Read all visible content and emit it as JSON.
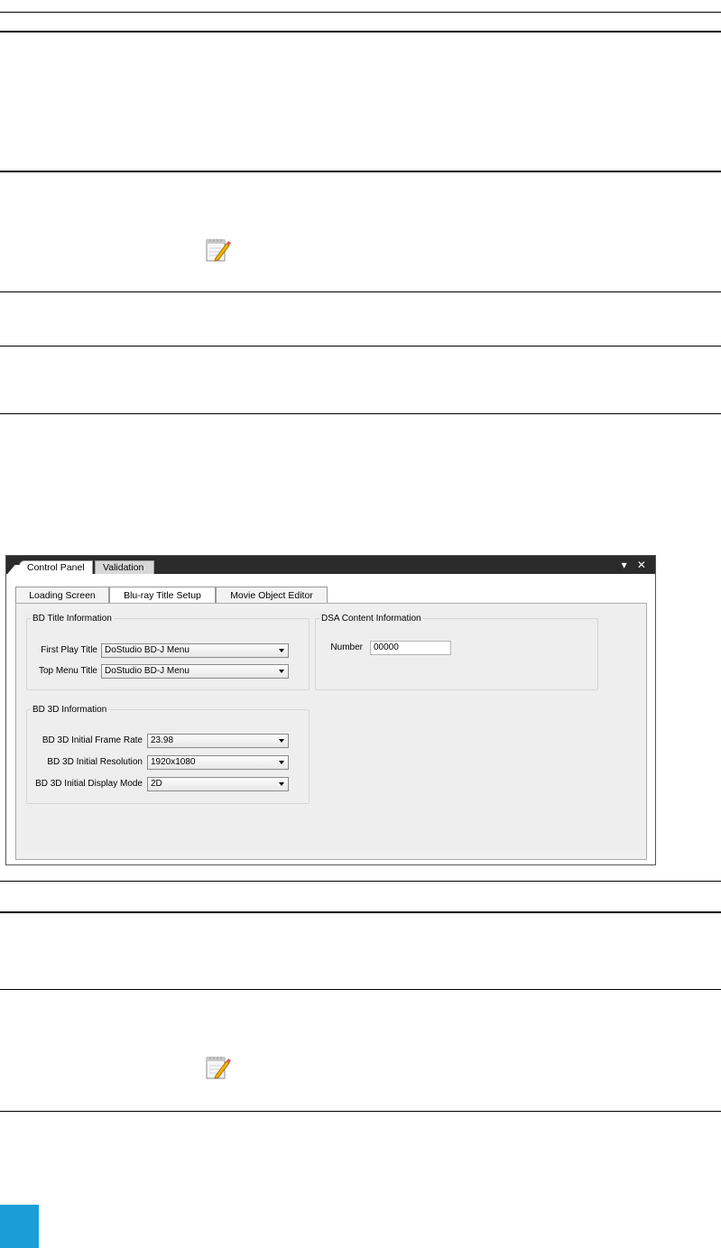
{
  "panel": {
    "doc_tabs": [
      "Control Panel",
      "Validation"
    ],
    "window_controls": "▾ ✕",
    "tabs": [
      "Loading Screen",
      "Blu-ray Title Setup",
      "Movie Object Editor"
    ],
    "bd_title": {
      "legend": "BD Title Information",
      "first_play_label": "First Play Title",
      "first_play_value": "DoStudio BD-J Menu",
      "top_menu_label": "Top Menu Title",
      "top_menu_value": "DoStudio BD-J Menu"
    },
    "dsa": {
      "legend": "DSA Content Information",
      "number_label": "Number",
      "number_value": "00000"
    },
    "bd_3d": {
      "legend": "BD 3D Information",
      "frame_rate_label": "BD 3D Initial Frame Rate",
      "frame_rate_value": "23.98",
      "resolution_label": "BD 3D Initial Resolution",
      "resolution_value": "1920x1080",
      "display_mode_label": "BD 3D Initial Display Mode",
      "display_mode_value": "2D"
    }
  },
  "colors": {
    "page_tab": "#1a9ed8",
    "panel_header": "#2b2b2b"
  },
  "icons": [
    "notepad-icon",
    "notepad-icon"
  ]
}
